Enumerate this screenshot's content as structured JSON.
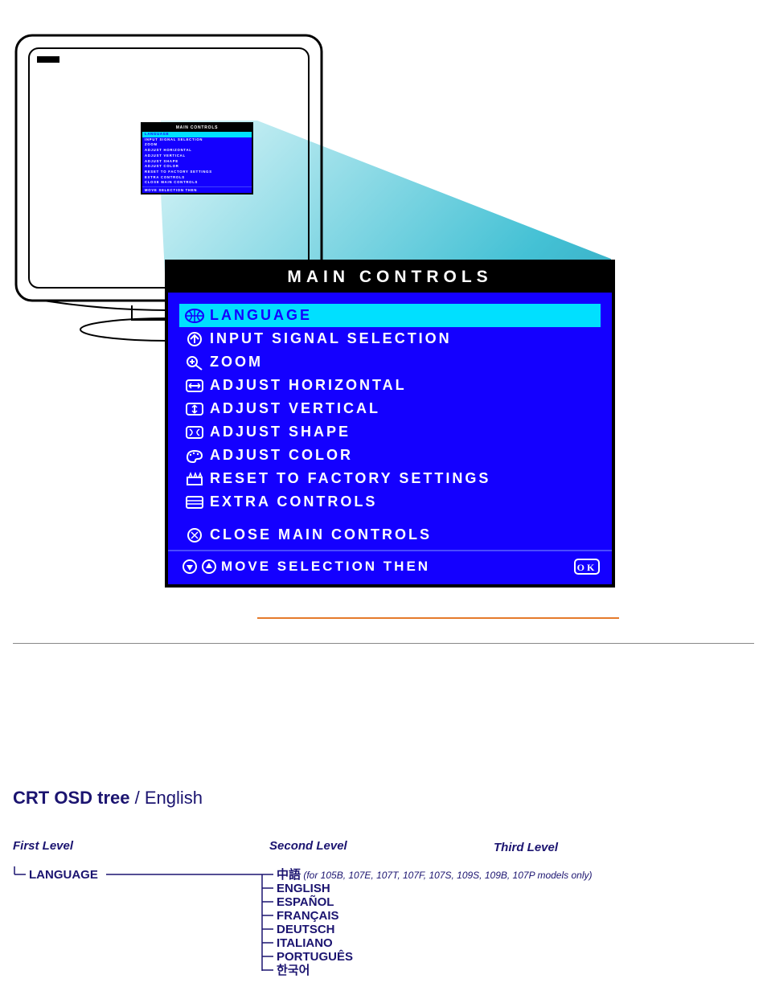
{
  "osd": {
    "title": "MAIN CONTROLS",
    "items": [
      {
        "icon": "language-icon",
        "label": "LANGUAGE",
        "selected": true
      },
      {
        "icon": "input-icon",
        "label": "INPUT SIGNAL SELECTION",
        "selected": false
      },
      {
        "icon": "zoom-icon",
        "label": "ZOOM",
        "selected": false
      },
      {
        "icon": "horiz-icon",
        "label": "ADJUST HORIZONTAL",
        "selected": false
      },
      {
        "icon": "vert-icon",
        "label": "ADJUST VERTICAL",
        "selected": false
      },
      {
        "icon": "shape-icon",
        "label": "ADJUST SHAPE",
        "selected": false
      },
      {
        "icon": "color-icon",
        "label": "ADJUST COLOR",
        "selected": false
      },
      {
        "icon": "reset-icon",
        "label": "RESET TO FACTORY SETTINGS",
        "selected": false
      },
      {
        "icon": "extra-icon",
        "label": "EXTRA CONTROLS",
        "selected": false
      }
    ],
    "close_label": "CLOSE MAIN CONTROLS",
    "footer_label": "MOVE SELECTION THEN",
    "footer_ok": "OK"
  },
  "tree": {
    "heading_bold": "CRT OSD tree",
    "heading_sep": " / ",
    "heading_lang": "English",
    "level1_label": "First Level",
    "level2_label": "Second Level",
    "level3_label": "Third Level",
    "root": "LANGUAGE",
    "children": [
      {
        "label": "中語",
        "note": " (for 105B, 107E, 107T, 107F, 107S, 109S, 109B, 107P models only)"
      },
      {
        "label": "ENGLISH"
      },
      {
        "label": "ESPAÑOL"
      },
      {
        "label": "FRANÇAIS"
      },
      {
        "label": "DEUTSCH"
      },
      {
        "label": "ITALIANO"
      },
      {
        "label": "PORTUGUÊS"
      },
      {
        "label": "한국어"
      }
    ]
  },
  "mini": {
    "title": "MAIN CONTROLS"
  }
}
